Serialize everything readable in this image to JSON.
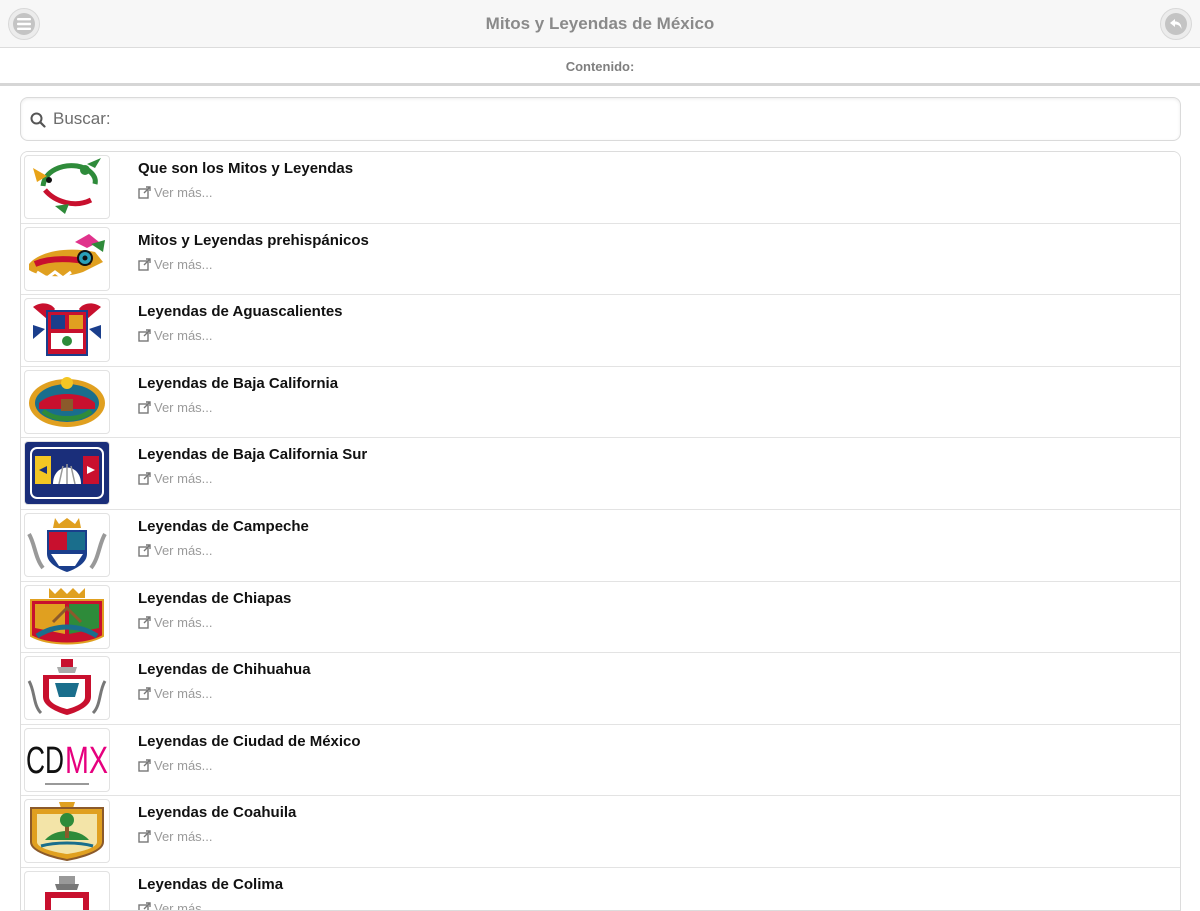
{
  "header": {
    "title": "Mitos y Leyendas de México",
    "menu_icon": "menu-icon",
    "back_icon": "back-icon"
  },
  "subheader": {
    "label": "Contenido:"
  },
  "search": {
    "placeholder": "Buscar:",
    "value": "",
    "icon": "search-icon"
  },
  "items": [
    {
      "title": "Que son los Mitos y Leyendas",
      "link": "Ver más...",
      "thumb": "dragon"
    },
    {
      "title": "Mitos y Leyendas prehispánicos",
      "link": "Ver más...",
      "thumb": "aztec-glyph"
    },
    {
      "title": "Leyendas de Aguascalientes",
      "link": "Ver más...",
      "thumb": "shield-red"
    },
    {
      "title": "Leyendas de Baja California",
      "link": "Ver más...",
      "thumb": "shield-sun"
    },
    {
      "title": "Leyendas de Baja California Sur",
      "link": "Ver más...",
      "thumb": "shield-shell"
    },
    {
      "title": "Leyendas de Campeche",
      "link": "Ver más...",
      "thumb": "shield-crown"
    },
    {
      "title": "Leyendas de Chiapas",
      "link": "Ver más...",
      "thumb": "shield-river"
    },
    {
      "title": "Leyendas de Chihuahua",
      "link": "Ver más...",
      "thumb": "shield-chihuahua"
    },
    {
      "title": "Leyendas de Ciudad de México",
      "link": "Ver más...",
      "thumb": "cdmx-logo",
      "logo_text": "CDMX"
    },
    {
      "title": "Leyendas de Coahuila",
      "link": "Ver más...",
      "thumb": "shield-coahuila"
    },
    {
      "title": "Leyendas de Colima",
      "link": "Ver más...",
      "thumb": "shield-colima"
    }
  ],
  "colors": {
    "header_bg": "#f7f7f7",
    "title_text": "#8a8a8a",
    "item_title": "#111111",
    "link_text": "#9a9a9a",
    "cdmx_magenta": "#e6007e"
  }
}
